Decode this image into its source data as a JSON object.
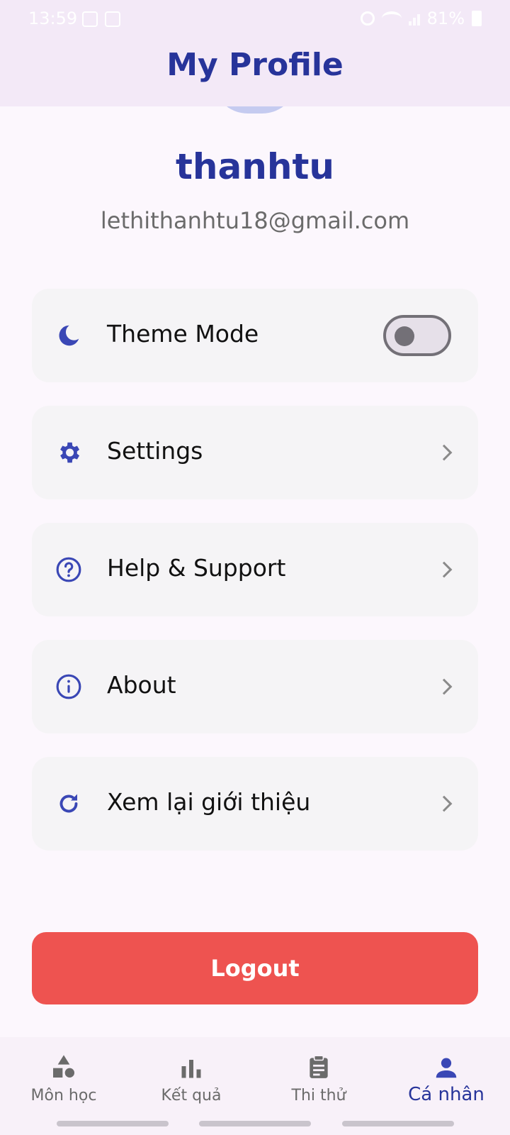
{
  "status_bar": {
    "time": "13:59",
    "battery": "81%"
  },
  "header": {
    "title": "My Profile"
  },
  "profile": {
    "username": "thanhtu",
    "email": "lethithanhtu18@gmail.com"
  },
  "menu": [
    {
      "label": "Theme Mode",
      "icon": "moon-icon",
      "control": "toggle",
      "toggle_on": false
    },
    {
      "label": "Settings",
      "icon": "gear-icon",
      "control": "chevron"
    },
    {
      "label": "Help & Support",
      "icon": "help-circle-icon",
      "control": "chevron"
    },
    {
      "label": "About",
      "icon": "info-circle-icon",
      "control": "chevron"
    },
    {
      "label": "Xem lại giới thiệu",
      "icon": "refresh-icon",
      "control": "chevron"
    }
  ],
  "logout": {
    "label": "Logout"
  },
  "bottom_nav": [
    {
      "label": "Môn học",
      "icon": "shapes-icon",
      "active": false
    },
    {
      "label": "Kết quả",
      "icon": "bar-chart-icon",
      "active": false
    },
    {
      "label": "Thi thử",
      "icon": "clipboard-icon",
      "active": false
    },
    {
      "label": "Cá nhân",
      "icon": "person-icon",
      "active": true
    }
  ],
  "colors": {
    "primary": "#27349a",
    "logout": "#ee5350",
    "card": "#f5f4f6",
    "header_bg": "#f3e9f7"
  }
}
